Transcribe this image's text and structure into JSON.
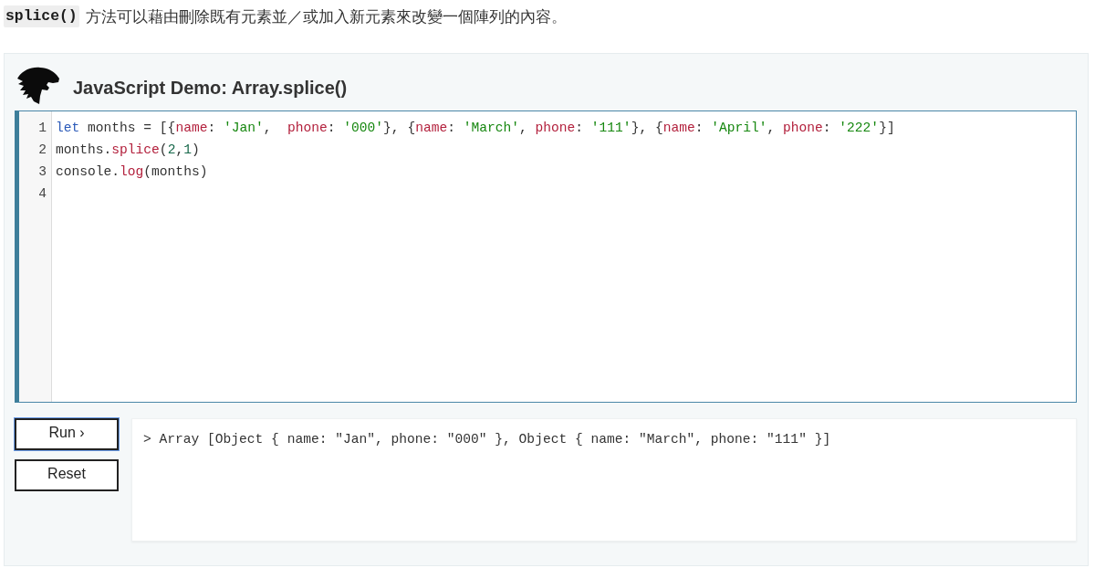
{
  "intro": {
    "code": "splice()",
    "text": "方法可以藉由刪除既有元素並／或加入新元素來改變一個陣列的內容。"
  },
  "demo": {
    "title": "JavaScript Demo: Array.splice()",
    "editor": {
      "lines": [
        {
          "number": "1",
          "tokens": [
            {
              "kind": "keyword",
              "text": "let"
            },
            {
              "kind": "plain",
              "text": " months = [{"
            },
            {
              "kind": "property",
              "text": "name"
            },
            {
              "kind": "plain",
              "text": ": "
            },
            {
              "kind": "string",
              "text": "'Jan'"
            },
            {
              "kind": "plain",
              "text": ",  "
            },
            {
              "kind": "property",
              "text": "phone"
            },
            {
              "kind": "plain",
              "text": ": "
            },
            {
              "kind": "string",
              "text": "'000'"
            },
            {
              "kind": "plain",
              "text": "}, {"
            },
            {
              "kind": "property",
              "text": "name"
            },
            {
              "kind": "plain",
              "text": ": "
            },
            {
              "kind": "string",
              "text": "'March'"
            },
            {
              "kind": "plain",
              "text": ", "
            },
            {
              "kind": "property",
              "text": "phone"
            },
            {
              "kind": "plain",
              "text": ": "
            },
            {
              "kind": "string",
              "text": "'111'"
            },
            {
              "kind": "plain",
              "text": "}, {"
            },
            {
              "kind": "property",
              "text": "name"
            },
            {
              "kind": "plain",
              "text": ": "
            },
            {
              "kind": "string",
              "text": "'April'"
            },
            {
              "kind": "plain",
              "text": ", "
            },
            {
              "kind": "property",
              "text": "phone"
            },
            {
              "kind": "plain",
              "text": ": "
            },
            {
              "kind": "string",
              "text": "'222'"
            },
            {
              "kind": "plain",
              "text": "}]"
            }
          ]
        },
        {
          "number": "2",
          "tokens": [
            {
              "kind": "plain",
              "text": "months."
            },
            {
              "kind": "property",
              "text": "splice"
            },
            {
              "kind": "plain",
              "text": "("
            },
            {
              "kind": "number",
              "text": "2"
            },
            {
              "kind": "plain",
              "text": ","
            },
            {
              "kind": "number",
              "text": "1"
            },
            {
              "kind": "plain",
              "text": ")"
            }
          ]
        },
        {
          "number": "3",
          "tokens": [
            {
              "kind": "plain",
              "text": "console."
            },
            {
              "kind": "property",
              "text": "log"
            },
            {
              "kind": "plain",
              "text": "(months)"
            }
          ]
        },
        {
          "number": "4"
        }
      ]
    },
    "buttons": [
      {
        "label": "Run ›",
        "focused": true
      },
      {
        "label": "Reset",
        "focused": false
      }
    ],
    "output": "> Array [Object { name: \"Jan\", phone: \"000\" }, Object { name: \"March\", phone: \"111\" }]"
  }
}
